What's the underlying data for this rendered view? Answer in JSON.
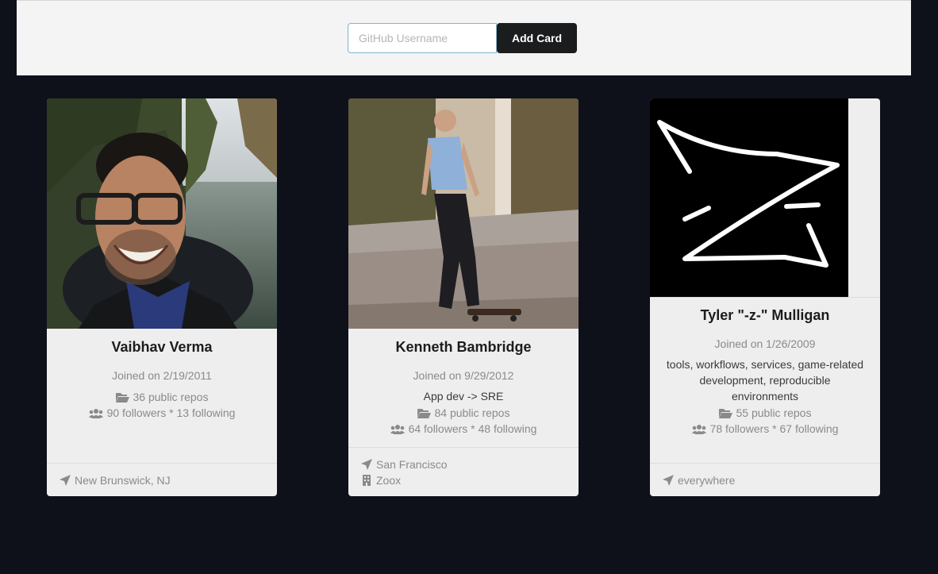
{
  "header": {
    "search_placeholder": "GitHub Username",
    "add_button": "Add Card"
  },
  "cards": [
    {
      "name": "Vaibhav Verma",
      "joined": "Joined on 2/19/2011",
      "repos": "36 public repos",
      "follow": "90 followers * 13 following",
      "location": "New Brunswick, NJ"
    },
    {
      "name": "Kenneth Bambridge",
      "joined": "Joined on 9/29/2012",
      "bio": "App dev -> SRE",
      "repos": "84 public repos",
      "follow": "64 followers * 48 following",
      "location": "San Francisco",
      "company": "Zoox"
    },
    {
      "name": "Tyler \"-z-\" Mulligan",
      "joined": "Joined on 1/26/2009",
      "bio": "tools, workflows, services, game-related development, reproducible environments",
      "repos": "55 public repos",
      "follow": "78 followers * 67 following",
      "location": "everywhere"
    }
  ],
  "icons": {
    "repos": "folder-open-icon",
    "followers": "users-icon",
    "location": "location-arrow-icon",
    "company": "building-icon"
  },
  "colors": {
    "page_bg": "#0e111a",
    "header_bg": "#f4f4f4",
    "card_bg": "#eeeeee",
    "button_bg": "#1b1c1d"
  }
}
